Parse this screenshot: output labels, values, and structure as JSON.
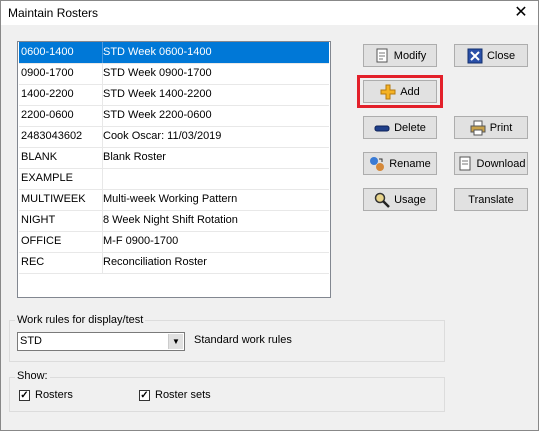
{
  "window": {
    "title": "Maintain Rosters",
    "close_glyph": "✕"
  },
  "rosters": [
    {
      "code": "0600-1400",
      "description": "STD Week 0600-1400",
      "selected": true
    },
    {
      "code": "0900-1700",
      "description": "STD Week 0900-1700"
    },
    {
      "code": "1400-2200",
      "description": "STD Week 1400-2200"
    },
    {
      "code": "2200-0600",
      "description": "STD Week 2200-0600"
    },
    {
      "code": "2483043602",
      "description": "Cook Oscar: 11/03/2019"
    },
    {
      "code": "BLANK",
      "description": "Blank Roster"
    },
    {
      "code": "EXAMPLE",
      "description": ""
    },
    {
      "code": "MULTIWEEK",
      "description": "Multi-week Working Pattern"
    },
    {
      "code": "NIGHT",
      "description": "8 Week Night Shift Rotation"
    },
    {
      "code": "OFFICE",
      "description": "M-F 0900-1700"
    },
    {
      "code": "REC",
      "description": "Reconciliation Roster"
    }
  ],
  "buttons": {
    "modify": "Modify",
    "add": "Add",
    "delete": "Delete",
    "rename": "Rename",
    "usage": "Usage",
    "close": "Close",
    "print": "Print",
    "download": "Download",
    "translate": "Translate"
  },
  "work_rules": {
    "legend": "Work rules for display/test",
    "selected": "STD",
    "description": "Standard work rules"
  },
  "show": {
    "legend": "Show:",
    "rosters_label": "Rosters",
    "rosters_checked": true,
    "roster_sets_label": "Roster sets",
    "roster_sets_checked": true
  },
  "colors": {
    "selection": "#0078d7",
    "highlight": "#e3202a"
  }
}
